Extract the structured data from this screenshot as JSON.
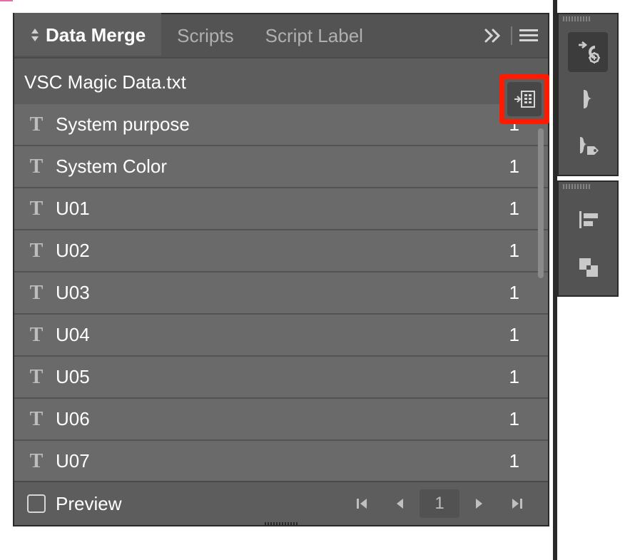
{
  "tabs": {
    "active": "Data Merge",
    "items": [
      "Data Merge",
      "Scripts",
      "Script Label"
    ]
  },
  "source_file": "VSC Magic Data.txt",
  "fields": [
    {
      "name": "System purpose",
      "count": "1"
    },
    {
      "name": "System Color",
      "count": "1"
    },
    {
      "name": "U01",
      "count": "1"
    },
    {
      "name": "U02",
      "count": "1"
    },
    {
      "name": "U03",
      "count": "1"
    },
    {
      "name": "U04",
      "count": "1"
    },
    {
      "name": "U05",
      "count": "1"
    },
    {
      "name": "U06",
      "count": "1"
    },
    {
      "name": "U07",
      "count": "1"
    }
  ],
  "footer": {
    "preview_label": "Preview",
    "page_number": "1"
  },
  "colors": {
    "panel_bg": "#535353",
    "row_bg": "#6a6a6a",
    "highlight": "#ff1a00"
  },
  "icons": {
    "sort": "sort-icon",
    "collapse": "chevrons-right-icon",
    "menu": "hamburger-icon",
    "create_merged": "create-merged-document-icon",
    "first": "first-page-icon",
    "prev": "prev-page-icon",
    "next": "next-page-icon",
    "last": "last-page-icon",
    "dock1": "data-merge-dock-icon",
    "dock2": "scripts-dock-icon",
    "dock3": "script-label-dock-icon",
    "dock4": "align-dock-icon",
    "dock5": "pathfinder-dock-icon"
  }
}
